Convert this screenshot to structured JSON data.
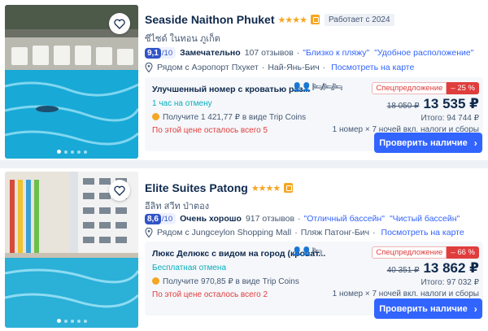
{
  "hotels": [
    {
      "name": "Seaside Naithon Phuket",
      "stars": "★★★★",
      "year_tag": "Работает с 2024",
      "local_name": "ซีไซด์ ในทอน ภูเก็ต",
      "score": "9,1",
      "score_den": "/10",
      "score_word": "Замечательно",
      "reviews": "107 отзывов",
      "tags": [
        "\"Близко к пляжу\"",
        "\"Удобное расположение\""
      ],
      "location": "Рядом с Аэропорт Пхукет",
      "area": "Най-Янь-Бич",
      "map_link": "Посмотреть на карте",
      "room_name": "Улучшенный номер с кроватью раз...",
      "room_icons": "👤👤 🛏/🛏🛏",
      "cancel": "1 час на отмену",
      "coins": "Получите 1 421,77 ₽ в виде Trip Coins",
      "left": "По этой цене осталось всего 5",
      "promo_label": "Спецпредложение",
      "promo_pct": "– 25 %",
      "old_price": "18 050 ₽",
      "new_price": "13 535 ₽",
      "total": "Итого: 94 744 ₽",
      "nights": "1 номер × 7 ночей вкл. налоги и сборы",
      "button": "Проверить наличие"
    },
    {
      "name": "Elite Suites Patong",
      "stars": "★★★★",
      "year_tag": "",
      "local_name": "อีลิท สวีท ป่าตอง",
      "score": "8,6",
      "score_den": "/10",
      "score_word": "Очень хорошо",
      "reviews": "917 отзывов",
      "tags": [
        "\"Отличный бассейн\"",
        "\"Чистый бассейн\""
      ],
      "location": "Рядом с Jungceylon Shopping Mall",
      "area": "Пляж Патонг-Бич",
      "map_link": "Посмотреть на карте",
      "room_name": "Люкс Делюкс с видом на город (кроват...",
      "room_icons": "👤👤 🛏",
      "cancel": "Бесплатная отмена",
      "coins": "Получите 970,85 ₽ в виде Trip Coins",
      "left": "По этой цене осталось всего 2",
      "promo_label": "Спецпредложение",
      "promo_pct": "– 66 %",
      "old_price": "40 351 ₽",
      "new_price": "13 862 ₽",
      "total": "Итого: 97 032 ₽",
      "nights": "1 номер × 7 ночей вкл. налоги и сборы",
      "button": "Проверить наличие"
    }
  ],
  "colors": {
    "brand_blue": "#3264ff",
    "score_blue": "#3053c6",
    "promo_red": "#e03d3d",
    "star_gold": "#f5a623",
    "teal": "#06aebd"
  }
}
